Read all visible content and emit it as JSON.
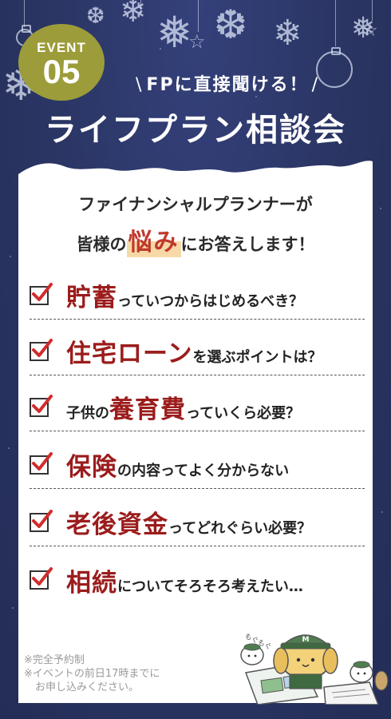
{
  "badge": {
    "label": "EVENT",
    "number": "05"
  },
  "header": {
    "subtitle": "FPに直接聞ける！",
    "title": "ライフプラン相談会"
  },
  "lead": {
    "line1": "ファイナンシャルプランナーが",
    "line2_before": "皆様の",
    "line2_highlight": "悩み",
    "line2_after": "にお答えします！"
  },
  "items": [
    {
      "keyword": "貯蓄",
      "rest": "っていつからはじめるべき？"
    },
    {
      "keyword": "住宅ローン",
      "rest": "を選ぶポイントは？"
    },
    {
      "pre": "子供の",
      "keyword": "養育費",
      "rest": "っていくら必要？"
    },
    {
      "keyword": "保険",
      "rest": "の内容ってよく分からない"
    },
    {
      "keyword": "老後資金",
      "rest": "ってどれぐらい必要？"
    },
    {
      "keyword": "相続",
      "rest": "についてそろそろ考えたい…"
    }
  ],
  "notes": {
    "line1": "※完全予約制",
    "line2": "※イベントの前日17時までに",
    "line3": "お申し込みください。"
  },
  "mascot": {
    "bubble": "もぐもぐ",
    "hat_mark": "M"
  },
  "colors": {
    "background": "#2a3563",
    "badge": "#9c9c3a",
    "keyword": "#9b1c1c",
    "highlight_text": "#c0392b",
    "highlight_marker": "#f7d9a8",
    "check_mark": "#d22c2c"
  }
}
